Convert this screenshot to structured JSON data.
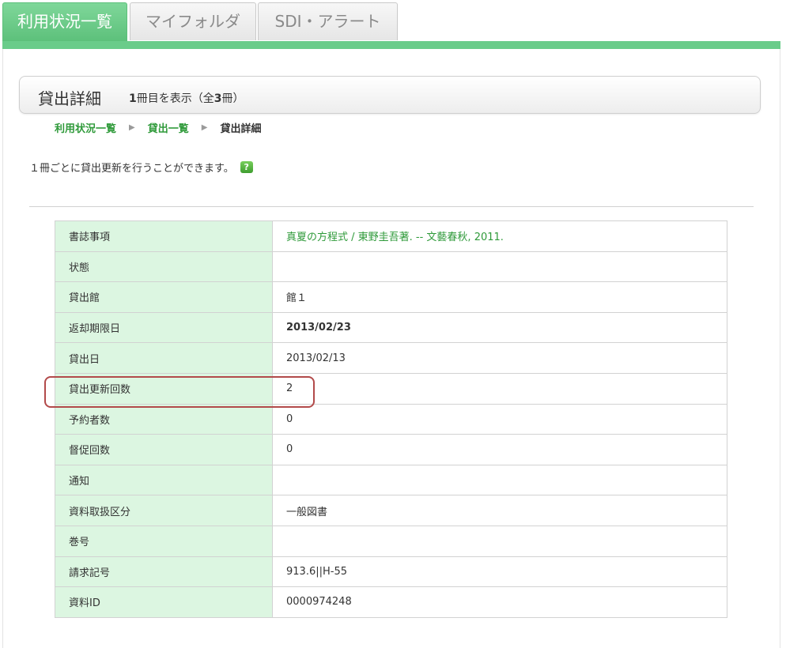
{
  "tabs": [
    {
      "label": "利用状況一覧",
      "active": true
    },
    {
      "label": "マイフォルダ",
      "active": false
    },
    {
      "label": "SDI・アラート",
      "active": false
    }
  ],
  "header": {
    "title": "貸出詳細",
    "count_prefix": "",
    "count_number": "1",
    "count_middle": "冊目を表示（全",
    "count_total": "3",
    "count_suffix": "冊）"
  },
  "breadcrumb": {
    "items": [
      "利用状況一覧",
      "貸出一覧"
    ],
    "current": "貸出詳細",
    "separator": "▶"
  },
  "notice": {
    "text": "１冊ごとに貸出更新を行うことができます。",
    "help": "?"
  },
  "details": [
    {
      "label": "書誌事項",
      "value": "真夏の方程式 / 東野圭吾著. -- 文藝春秋, 2011.",
      "style": "link"
    },
    {
      "label": "状態",
      "value": ""
    },
    {
      "label": "貸出館",
      "value": "館１"
    },
    {
      "label": "返却期限日",
      "value": "2013/02/23",
      "style": "bold"
    },
    {
      "label": "貸出日",
      "value": "2013/02/13"
    },
    {
      "label": "貸出更新回数",
      "value": "2"
    },
    {
      "label": "予約者数",
      "value": "0"
    },
    {
      "label": "督促回数",
      "value": "0"
    },
    {
      "label": "通知",
      "value": ""
    },
    {
      "label": "資料取扱区分",
      "value": "一般図書"
    },
    {
      "label": "巻号",
      "value": ""
    },
    {
      "label": "請求記号",
      "value": "913.6||H-55"
    },
    {
      "label": "資料ID",
      "value": "0000974248"
    }
  ],
  "colors": {
    "accent": "#6acc8a",
    "link": "#2f9a3a",
    "label_bg": "#dcf6e1",
    "highlight": "#b24a4a"
  }
}
